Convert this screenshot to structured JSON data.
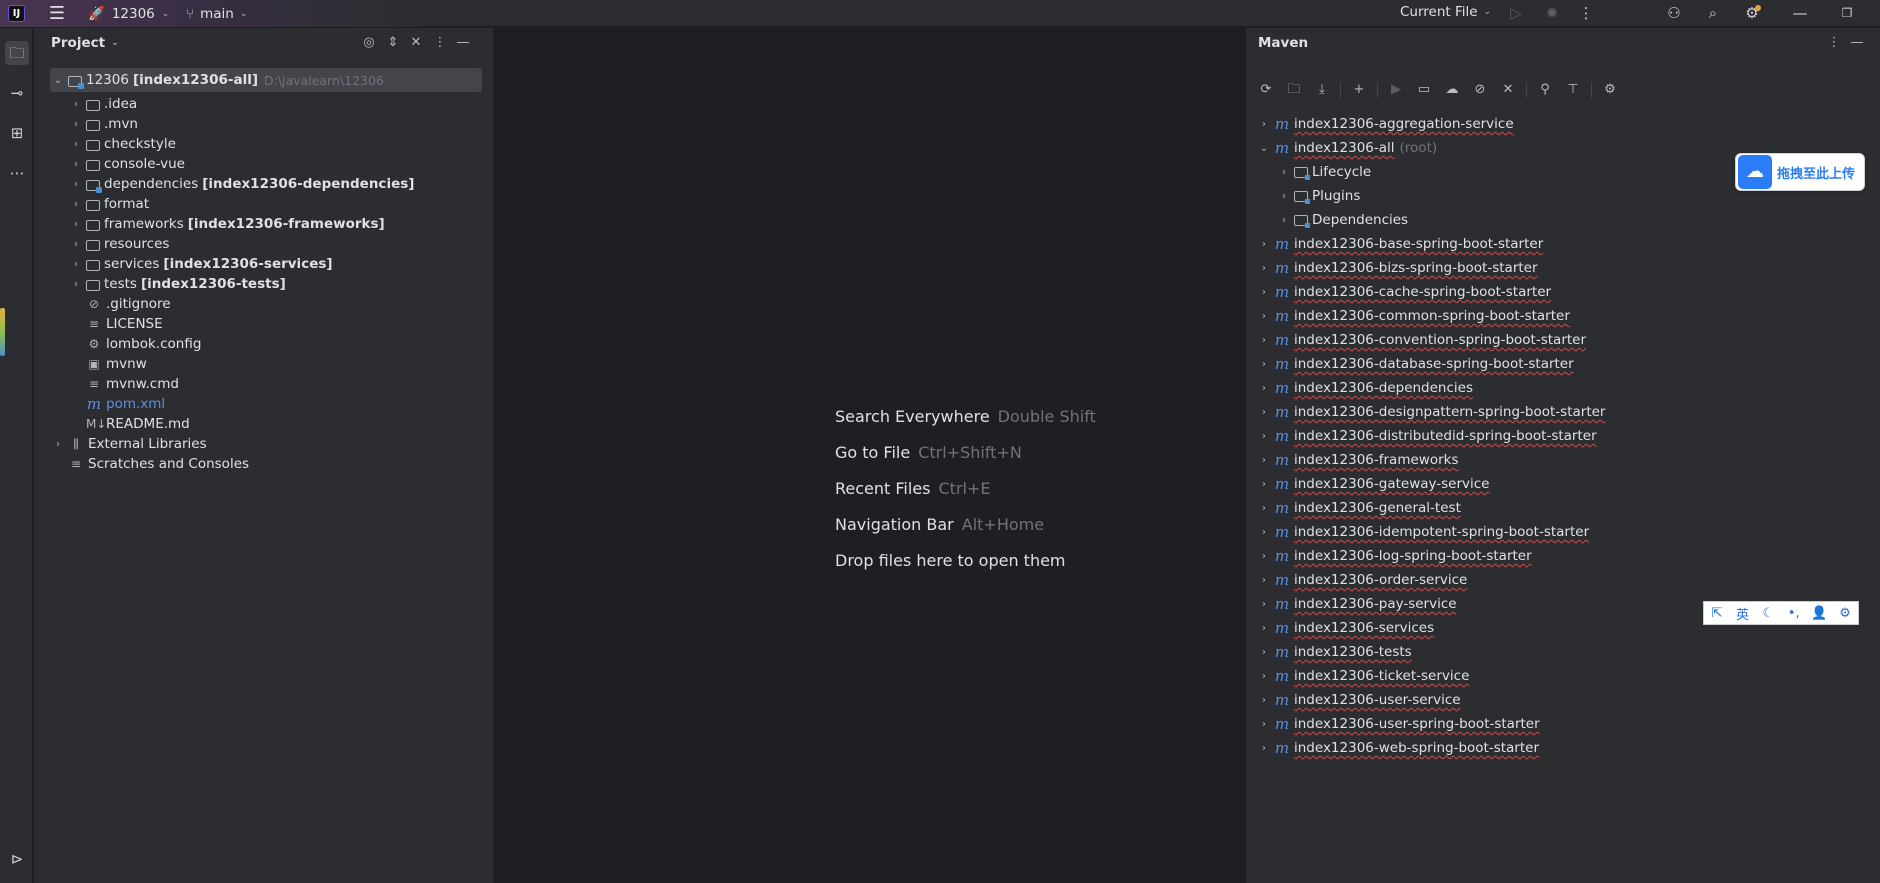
{
  "titlebar": {
    "logo": "IJ",
    "project_name": "12306",
    "branch": "main",
    "run_config": "Current File",
    "icons": [
      "menu-icon",
      "rocket-icon",
      "branch-icon",
      "run-icon",
      "debug-icon",
      "more-icon",
      "add-user-icon",
      "search-icon",
      "settings-icon",
      "minimize-icon",
      "restore-icon"
    ]
  },
  "leftstrip": {
    "icons": [
      "folder-icon",
      "commit-icon",
      "structure-icon",
      "more-icon",
      "services-icon"
    ]
  },
  "project": {
    "title": "Project",
    "root": {
      "name": "12306",
      "module": "[index12306-all]",
      "path": "D:\\javalearn\\12306"
    },
    "items": [
      {
        "name": ".idea",
        "module": "",
        "type": "folder",
        "expandable": true
      },
      {
        "name": ".mvn",
        "module": "",
        "type": "folder",
        "expandable": true
      },
      {
        "name": "checkstyle",
        "module": "",
        "type": "folder",
        "expandable": true
      },
      {
        "name": "console-vue",
        "module": "",
        "type": "folder",
        "expandable": true
      },
      {
        "name": "dependencies",
        "module": "[index12306-dependencies]",
        "type": "module",
        "expandable": true
      },
      {
        "name": "format",
        "module": "",
        "type": "folder",
        "expandable": true
      },
      {
        "name": "frameworks",
        "module": "[index12306-frameworks]",
        "type": "folder",
        "expandable": true
      },
      {
        "name": "resources",
        "module": "",
        "type": "folder",
        "expandable": true
      },
      {
        "name": "services",
        "module": "[index12306-services]",
        "type": "folder",
        "expandable": true
      },
      {
        "name": "tests",
        "module": "[index12306-tests]",
        "type": "folder",
        "expandable": true
      },
      {
        "name": ".gitignore",
        "module": "",
        "type": "ignore",
        "expandable": false
      },
      {
        "name": "LICENSE",
        "module": "",
        "type": "text",
        "expandable": false
      },
      {
        "name": "lombok.config",
        "module": "",
        "type": "config",
        "expandable": false
      },
      {
        "name": "mvnw",
        "module": "",
        "type": "shell",
        "expandable": false
      },
      {
        "name": "mvnw.cmd",
        "module": "",
        "type": "text",
        "expandable": false
      },
      {
        "name": "pom.xml",
        "module": "",
        "type": "maven",
        "expandable": false
      },
      {
        "name": "README.md",
        "module": "",
        "type": "markdown",
        "expandable": false
      }
    ],
    "external_libraries": "External Libraries",
    "scratches": "Scratches and Consoles"
  },
  "editor_hints": [
    {
      "label": "Search Everywhere",
      "key": "Double Shift"
    },
    {
      "label": "Go to File",
      "key": "Ctrl+Shift+N"
    },
    {
      "label": "Recent Files",
      "key": "Ctrl+E"
    },
    {
      "label": "Navigation Bar",
      "key": "Alt+Home"
    },
    {
      "label": "Drop files here to open them",
      "key": ""
    }
  ],
  "maven": {
    "title": "Maven",
    "toolbar_icons": [
      "reload-icon",
      "add-folder-icon",
      "download-icon",
      "plus-icon",
      "run-icon",
      "execute-goal-icon",
      "offline-icon",
      "skip-tests-icon",
      "collapse-icon",
      "analyze-icon",
      "show-deps-icon",
      "settings-icon"
    ],
    "projects_before": [
      "index12306-aggregation-service"
    ],
    "root_project": "index12306-all",
    "root_hint": "(root)",
    "root_children": [
      "Lifecycle",
      "Plugins",
      "Dependencies"
    ],
    "projects_after": [
      "index12306-base-spring-boot-starter",
      "index12306-bizs-spring-boot-starter",
      "index12306-cache-spring-boot-starter",
      "index12306-common-spring-boot-starter",
      "index12306-convention-spring-boot-starter",
      "index12306-database-spring-boot-starter",
      "index12306-dependencies",
      "index12306-designpattern-spring-boot-starter",
      "index12306-distributedid-spring-boot-starter",
      "index12306-frameworks",
      "index12306-gateway-service",
      "index12306-general-test",
      "index12306-idempotent-spring-boot-starter",
      "index12306-log-spring-boot-starter",
      "index12306-order-service",
      "index12306-pay-service",
      "index12306-services",
      "index12306-tests",
      "index12306-ticket-service",
      "index12306-user-service",
      "index12306-user-spring-boot-starter",
      "index12306-web-spring-boot-starter"
    ]
  },
  "upload_widget": {
    "label": "拖拽至此上传"
  },
  "ime_bar": {
    "items": [
      "⇱",
      "英",
      "☾",
      "•,",
      "👤",
      "⚙"
    ]
  }
}
